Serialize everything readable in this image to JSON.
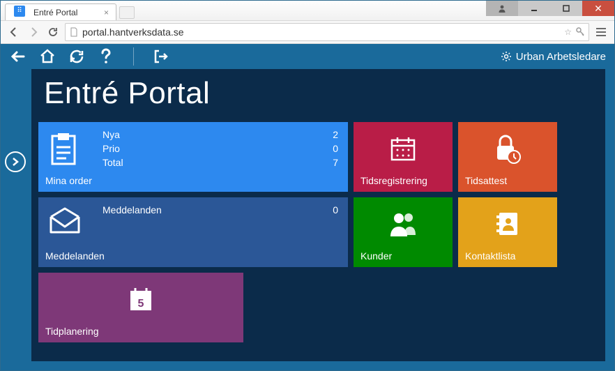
{
  "browser": {
    "tab_title": "Entré Portal",
    "url": "portal.hantverksdata.se"
  },
  "app": {
    "title": "Entré Portal",
    "user_label": "Urban Arbetsledare"
  },
  "tiles": {
    "orders": {
      "title": "Mina order",
      "stats": {
        "nya_label": "Nya",
        "nya_value": "2",
        "prio_label": "Prio",
        "prio_value": "0",
        "total_label": "Total",
        "total_value": "7"
      }
    },
    "messages": {
      "title": "Meddelanden",
      "stat_label": "Meddelanden",
      "stat_value": "0"
    },
    "tidsreg": {
      "title": "Tidsregistrering"
    },
    "tidsattest": {
      "title": "Tidsattest"
    },
    "kunder": {
      "title": "Kunder"
    },
    "kontakt": {
      "title": "Kontaktlista"
    },
    "tidplan": {
      "title": "Tidplanering",
      "day": "5"
    }
  }
}
